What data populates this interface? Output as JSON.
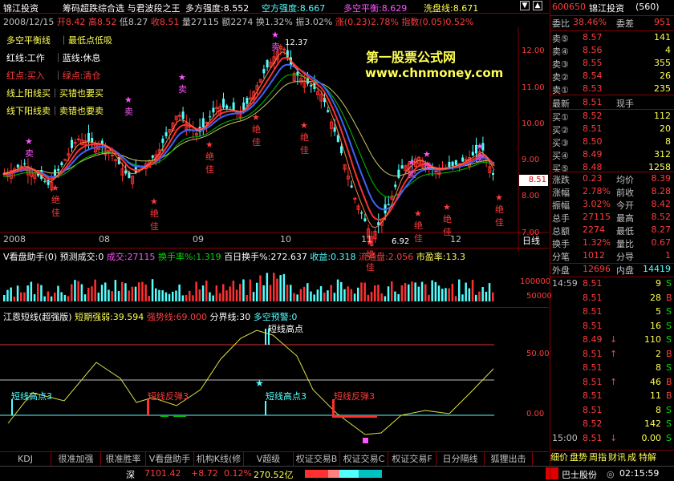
{
  "stock": {
    "name": "锦江投资",
    "code": "600650"
  },
  "indicator_title": "筹码超跌综合选 与君波段之王",
  "indicator_vals": {
    "duo": "多方强度:8.552",
    "kong": "空方强度:8.667",
    "pingheng": "多空平衡:8.629",
    "xipan": "洗盘线:8.671"
  },
  "date_line": {
    "date": "2008/12/15",
    "open": "开8.42",
    "high": "高8.52",
    "low": "低8.27",
    "close": "收8.51",
    "vol": "量27115",
    "amt": "额2274",
    "turn": "换1.32%",
    "amp": "振3.02%",
    "chg": "涨(0.23)2.78%",
    "idx": "指数(0.05)0.52%"
  },
  "legend": [
    {
      "a": "多空平衡线",
      "b": "最低点低吸"
    },
    {
      "a": "红线:工作",
      "b": "蓝线:休息"
    },
    {
      "a": "红点:买入",
      "b": "绿点:清仓"
    },
    {
      "a": "线上阳线买",
      "b": "买错也要买"
    },
    {
      "a": "线下阳线卖",
      "b": "卖错也要卖"
    }
  ],
  "watermark": {
    "cn": "第一股票公式网",
    "url": "www.chnmoney.com"
  },
  "price_axis": [
    "12.00",
    "11.00",
    "10.00",
    "9.00",
    "8.00",
    "7.00"
  ],
  "current_price": "8.51",
  "annotations": {
    "high": "12.37",
    "low": "6.92",
    "sell": "卖",
    "buy": "绝佳"
  },
  "months": [
    "2008",
    "08",
    "09",
    "10",
    "11",
    "12"
  ],
  "period": "日线",
  "vol_title": {
    "name": "V看盘助手(0)",
    "pred": "预测成交:0",
    "cj": "成交:27115",
    "hsl": "换手率%:1.319",
    "bai": "百日换手%:272.637",
    "shouyi": "收益:0.318",
    "liutong": "流通盘:2.056",
    "syl": "市盈率:13.3"
  },
  "vol_axis": [
    "100000",
    "50000"
  ],
  "osc_title": {
    "name": "江恩短线(超强版)",
    "q": "短期强弱:39.594",
    "qs": "强势线:69.000",
    "fj": "分界线:30",
    "dk": "多空预警:0"
  },
  "osc_axis": [
    "50.00",
    "0.00"
  ],
  "osc_labels": {
    "high": "短线高点3",
    "rebound": "短线反弹3",
    "top": "短线高点"
  },
  "tabs": [
    "KDJ",
    "很准加强",
    "很准胜率",
    "V看盘助手",
    "机构K线(修",
    "V超级MACD",
    "权证交易B",
    "权证交易C",
    "权证交易F",
    "日分隔线",
    "狐狸出击"
  ],
  "status": {
    "market": "深",
    "idx": "7101.42",
    "chg": "+8.72",
    "pct": "0.12%",
    "amt": "270.52亿",
    "alert": "巴士股份",
    "time": "02:15:59"
  },
  "panel": {
    "header_name": "锦江投资",
    "header_id": "(560)",
    "webi_label": "委比",
    "webi": "38.46%",
    "weicha_label": "委差",
    "weicha": "951",
    "sells": [
      {
        "l": "卖⑤",
        "p": "8.57",
        "v": "141"
      },
      {
        "l": "卖④",
        "p": "8.56",
        "v": "4"
      },
      {
        "l": "卖③",
        "p": "8.55",
        "v": "355"
      },
      {
        "l": "卖②",
        "p": "8.54",
        "v": "26"
      },
      {
        "l": "卖①",
        "p": "8.53",
        "v": "235"
      }
    ],
    "latest_label": "最新",
    "latest": "8.51",
    "xianshou_label": "现手",
    "buys": [
      {
        "l": "买①",
        "p": "8.52",
        "v": "112"
      },
      {
        "l": "买②",
        "p": "8.51",
        "v": "20"
      },
      {
        "l": "买③",
        "p": "8.50",
        "v": "8"
      },
      {
        "l": "买④",
        "p": "8.49",
        "v": "312"
      },
      {
        "l": "买⑤",
        "p": "8.48",
        "v": "1258"
      }
    ],
    "stats": [
      {
        "a": "涨跌",
        "av": "0.23",
        "b": "均价",
        "bv": "8.39"
      },
      {
        "a": "涨幅",
        "av": "2.78%",
        "b": "前收",
        "bv": "8.28"
      },
      {
        "a": "振幅",
        "av": "3.02%",
        "b": "今开",
        "bv": "8.42"
      },
      {
        "a": "总手",
        "av": "27115",
        "b": "最高",
        "bv": "8.52"
      },
      {
        "a": "总额",
        "av": "2274",
        "b": "最低",
        "bv": "8.27"
      },
      {
        "a": "换手",
        "av": "1.32%",
        "b": "量比",
        "bv": "0.67"
      },
      {
        "a": "分笔",
        "av": "1012",
        "b": "分导",
        "bv": "1"
      }
    ],
    "wai_label": "外盘",
    "wai": "12696",
    "nei_label": "内盘",
    "nei": "14419",
    "ticks": [
      {
        "t": "14:59",
        "p": "8.51",
        "d": "",
        "v": "9",
        "s": "S"
      },
      {
        "t": "",
        "p": "8.51",
        "d": "",
        "v": "28",
        "s": "B"
      },
      {
        "t": "",
        "p": "8.51",
        "d": "",
        "v": "5",
        "s": "S"
      },
      {
        "t": "",
        "p": "8.51",
        "d": "",
        "v": "16",
        "s": "S"
      },
      {
        "t": "",
        "p": "8.49",
        "d": "↓",
        "v": "110",
        "s": "S"
      },
      {
        "t": "",
        "p": "8.51",
        "d": "↑",
        "v": "2",
        "s": "B"
      },
      {
        "t": "",
        "p": "8.51",
        "d": "",
        "v": "8",
        "s": "S"
      },
      {
        "t": "",
        "p": "8.51",
        "d": "↑",
        "v": "46",
        "s": "B"
      },
      {
        "t": "",
        "p": "8.51",
        "d": "",
        "v": "11",
        "s": "B"
      },
      {
        "t": "",
        "p": "8.51",
        "d": "",
        "v": "8",
        "s": "S"
      },
      {
        "t": "",
        "p": "8.52",
        "d": "",
        "v": "142",
        "s": "S"
      },
      {
        "t": "15:00",
        "p": "8.51",
        "d": "↓",
        "v": "0.00",
        "s": "S"
      }
    ],
    "bottom_links": [
      "细价",
      "盘势",
      "周指",
      "财讯",
      "成",
      "特解"
    ]
  }
}
